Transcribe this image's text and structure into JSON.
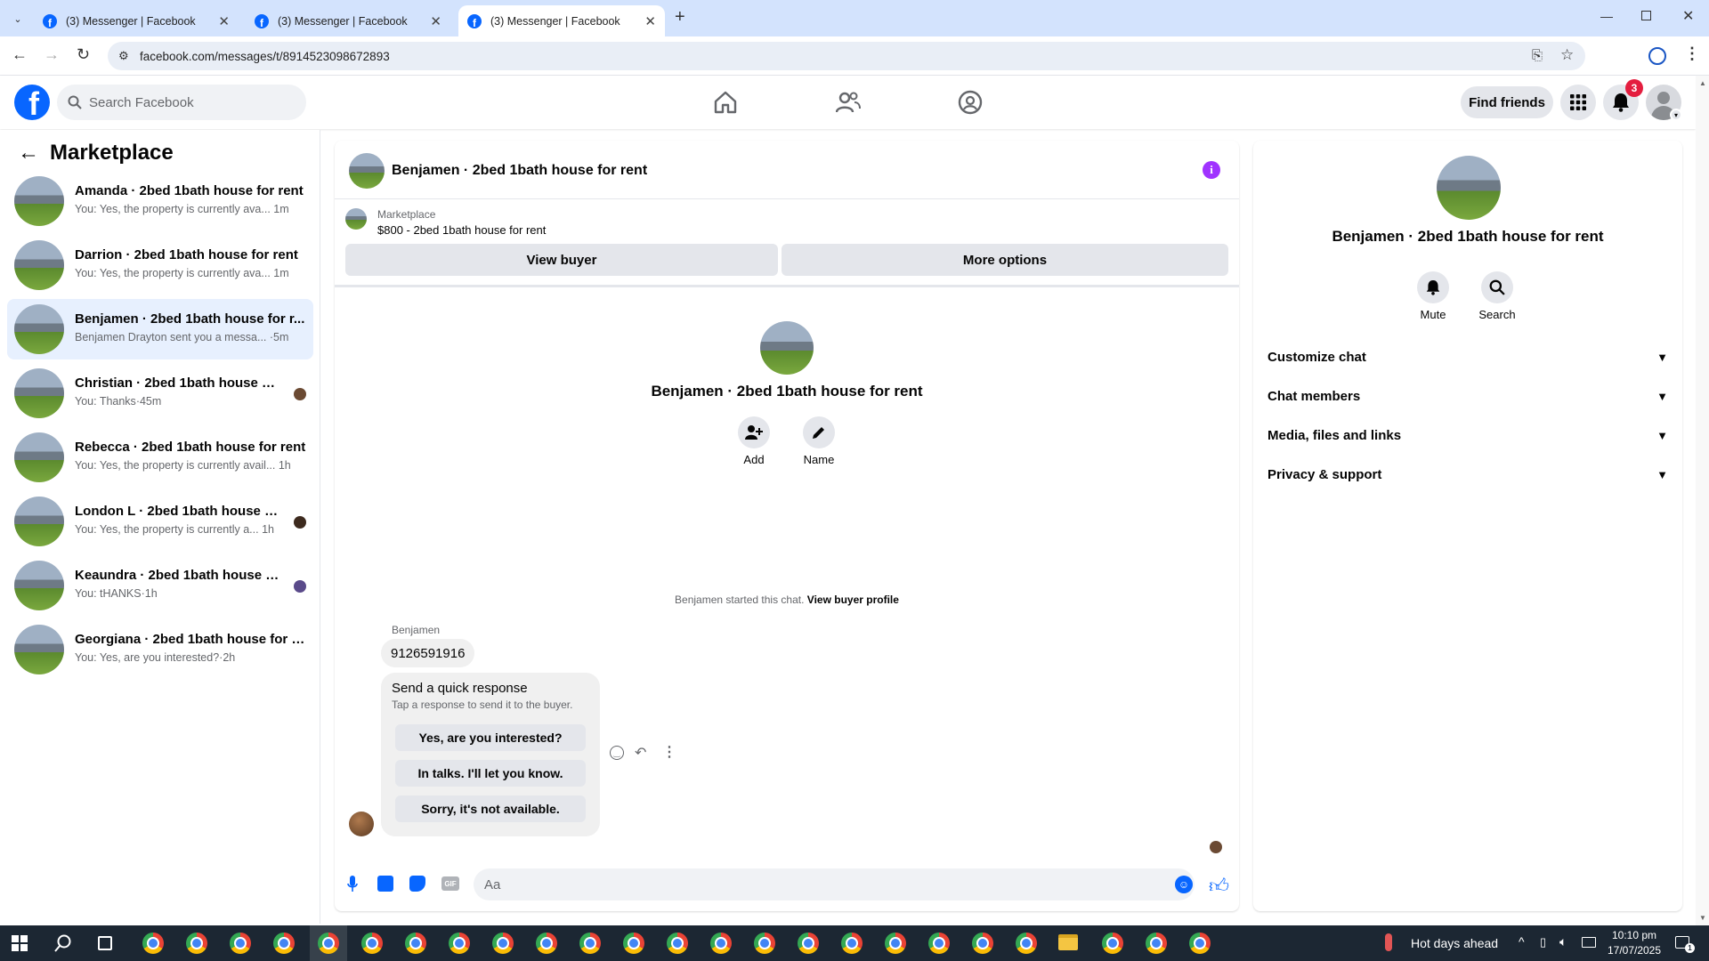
{
  "browser": {
    "tabs": [
      {
        "title": "(3) Messenger | Facebook"
      },
      {
        "title": "(3) Messenger | Facebook"
      },
      {
        "title": "(3) Messenger | Facebook"
      }
    ],
    "url": "facebook.com/messages/t/8914523098672893"
  },
  "fbnav": {
    "search_placeholder": "Search Facebook",
    "find_friends": "Find friends",
    "notif_count": "3"
  },
  "left": {
    "title": "Marketplace",
    "conversations": [
      {
        "name": "Amanda · 2bed 1bath house for rent",
        "preview": "You: Yes, the property is currently ava...",
        "time": "1m"
      },
      {
        "name": "Darrion · 2bed 1bath house for rent",
        "preview": "You: Yes, the property is currently ava...",
        "time": "1m"
      },
      {
        "name": "Benjamen · 2bed 1bath house for r...",
        "preview": "Benjamen Drayton sent you a messa...",
        "time": "·5m"
      },
      {
        "name": "Christian · 2bed 1bath house for...",
        "preview": "You: Thanks",
        "time": "·45m"
      },
      {
        "name": "Rebecca · 2bed 1bath house for rent",
        "preview": "You: Yes, the property is currently avail...",
        "time": "1h"
      },
      {
        "name": "London L · 2bed 1bath house for...",
        "preview": "You: Yes, the property is currently a...",
        "time": "1h"
      },
      {
        "name": "Keaundra · 2bed 1bath house fo...",
        "preview": "You: tHANKS",
        "time": "·1h"
      },
      {
        "name": "Georgiana · 2bed 1bath house for r...",
        "preview": "You: Yes, are you interested?",
        "time": "·2h"
      }
    ]
  },
  "chat": {
    "header_title": "Benjamen · 2bed 1bath house for rent",
    "listing_source": "Marketplace",
    "listing_title": "$800 - 2bed 1bath house for rent",
    "view_buyer": "View buyer",
    "more_options": "More options",
    "center_title": "Benjamen · 2bed 1bath house for rent",
    "add_label": "Add",
    "name_label": "Name",
    "started_text": "Benjamen started this chat.",
    "view_buyer_profile": "View buyer profile",
    "sender": "Benjamen",
    "message": "9126591916",
    "quick_title": "Send a quick response",
    "quick_sub": "Tap a response to send it to the buyer.",
    "quick_responses": [
      "Yes, are you interested?",
      "In talks. I'll let you know.",
      "Sorry, it's not available."
    ],
    "composer_placeholder": "Aa"
  },
  "info": {
    "title": "Benjamen · 2bed 1bath house for rent",
    "mute": "Mute",
    "search": "Search",
    "sections": [
      "Customize chat",
      "Chat members",
      "Media, files and links",
      "Privacy & support"
    ]
  },
  "taskbar": {
    "weather": "Hot days ahead",
    "time": "10:10 pm",
    "date": "17/07/2025"
  },
  "colors": {
    "accent": "#0866ff",
    "messenger_purple": "#a033ff",
    "notif_red": "#e41e3f"
  }
}
